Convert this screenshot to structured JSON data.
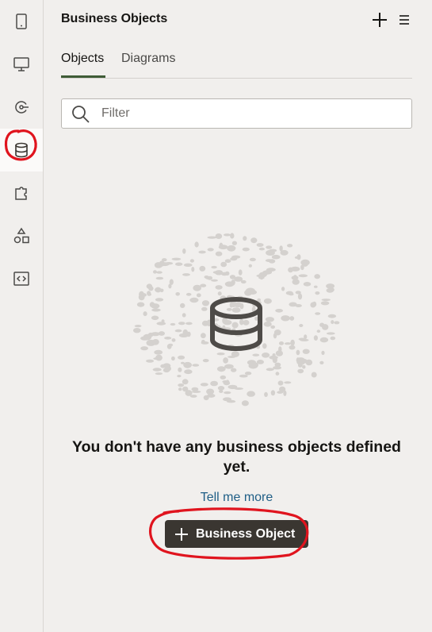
{
  "rail": {
    "items": [
      {
        "icon": "mobile-icon"
      },
      {
        "icon": "monitor-icon"
      },
      {
        "icon": "flow-icon"
      },
      {
        "icon": "database-icon",
        "active": true
      },
      {
        "icon": "puzzle-icon"
      },
      {
        "icon": "shapes-icon"
      },
      {
        "icon": "code-icon"
      }
    ]
  },
  "header": {
    "title": "Business Objects",
    "add_icon": "plus-icon",
    "menu_icon": "hamburger-menu-icon"
  },
  "tabs": [
    {
      "label": "Objects",
      "selected": true
    },
    {
      "label": "Diagrams",
      "selected": false
    }
  ],
  "filter": {
    "placeholder": "Filter",
    "value": "",
    "icon": "search-icon"
  },
  "empty_state": {
    "icon": "database-icon",
    "message": "You don't have any business objects defined yet.",
    "link": "Tell me more",
    "button_label": "Business Object",
    "button_icon": "plus-icon"
  },
  "colors": {
    "background": "#f1efed",
    "tab_accent": "#3f5c36",
    "link": "#1f5e86",
    "button": "#3a3631",
    "annotation": "#e0141e"
  }
}
